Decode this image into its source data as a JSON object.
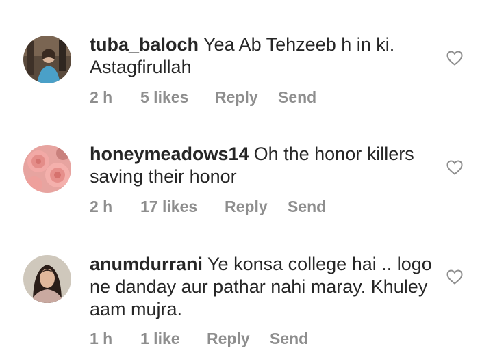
{
  "comments": [
    {
      "username": "tuba_baloch",
      "text": "Yea Ab Tehzeeb h in ki. Astagfirullah",
      "time": "2 h",
      "likes": "5 likes",
      "reply_label": "Reply",
      "send_label": "Send",
      "avatar": "profile-photo-woman"
    },
    {
      "username": "honeymeadows14",
      "text": "Oh the honor killers saving their honor",
      "time": "2 h",
      "likes": "17 likes",
      "reply_label": "Reply",
      "send_label": "Send",
      "avatar": "profile-photo-pink-roses"
    },
    {
      "username": "anumdurrani",
      "text": "Ye konsa college hai .. logo ne danday aur pathar nahi maray. Khuley aam mujra.",
      "time": "1 h",
      "likes": "1 like",
      "reply_label": "Reply",
      "send_label": "Send",
      "avatar": "profile-photo-woman"
    }
  ],
  "icons": {
    "like": "heart-outline-icon"
  },
  "colors": {
    "text": "#262626",
    "meta": "#8e8e8e"
  }
}
